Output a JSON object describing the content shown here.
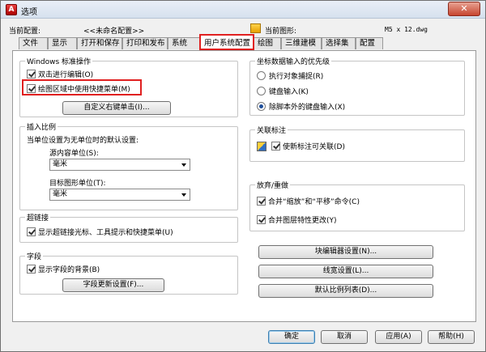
{
  "window": {
    "title": "选项",
    "close_label": "✕"
  },
  "header": {
    "profile_label": "当前配置:",
    "profile_value": "<<未命名配置>>",
    "drawing_label": "当前图形:",
    "drawing_value": "M5 x 12.dwg"
  },
  "tabs": [
    "文件",
    "显示",
    "打开和保存",
    "打印和发布",
    "系统",
    "用户系统配置",
    "绘图",
    "三维建模",
    "选择集",
    "配置"
  ],
  "windows_group": {
    "title": "Windows 标准操作",
    "dblclick_label": "双击进行编辑(O)",
    "dblclick_checked": true,
    "shortcut_label": "绘图区域中使用快捷菜单(M)",
    "shortcut_checked": true,
    "customize_button": "自定义右键单击(I)..."
  },
  "insertion_group": {
    "title": "插入比例",
    "desc": "当单位设置为无单位时的默认设置:",
    "source_label": "源内容单位(S):",
    "source_value": "毫米",
    "target_label": "目标图形单位(T):",
    "target_value": "毫米"
  },
  "hyperlink_group": {
    "title": "超链接",
    "show_label": "显示超链接光标、工具提示和快捷菜单(U)",
    "show_checked": true
  },
  "field_group": {
    "title": "字段",
    "bg_label": "显示字段的背景(B)",
    "bg_checked": true,
    "update_button": "字段更新设置(F)..."
  },
  "priority_group": {
    "title": "坐标数据输入的优先级",
    "options": [
      "执行对象捕捉(R)",
      "键盘输入(K)",
      "除脚本外的键盘输入(X)"
    ],
    "selected_index": 2
  },
  "assoc_group": {
    "title": "关联标注",
    "assoc_label": "使新标注可关联(D)",
    "assoc_checked": true
  },
  "undo_group": {
    "title": "放弃/重做",
    "zoom_pan_label": "合并“缩放”和“平移”命令(C)",
    "zoom_pan_checked": true,
    "layer_label": "合并图层特性更改(Y)",
    "layer_checked": true
  },
  "right_buttons": {
    "block_editor": "块编辑器设置(N)...",
    "lineweight": "线宽设置(L)...",
    "scale_list": "默认比例列表(D)..."
  },
  "footer": {
    "ok": "确定",
    "cancel": "取消",
    "apply": "应用(A)",
    "help": "帮助(H)"
  }
}
